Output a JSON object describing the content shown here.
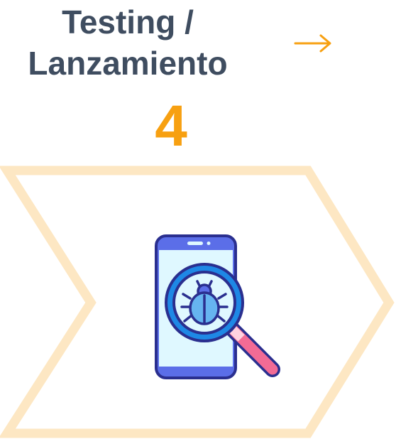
{
  "step": {
    "title_line1": "Testing /",
    "title_line2": "Lanzamiento",
    "number": "4"
  },
  "icons": {
    "next": "arrow-right-icon",
    "illustration": "bug-search-phone-icon"
  },
  "colors": {
    "title": "#3f4d60",
    "accent": "#f7a011",
    "chevron_outline": "#fde7c3",
    "phone_body": "#5b6ee8",
    "phone_screen": "#dff8ff",
    "magnifier_ring": "#1e88e5",
    "magnifier_handle": "#f26b95",
    "outline": "#2a2f8f"
  }
}
